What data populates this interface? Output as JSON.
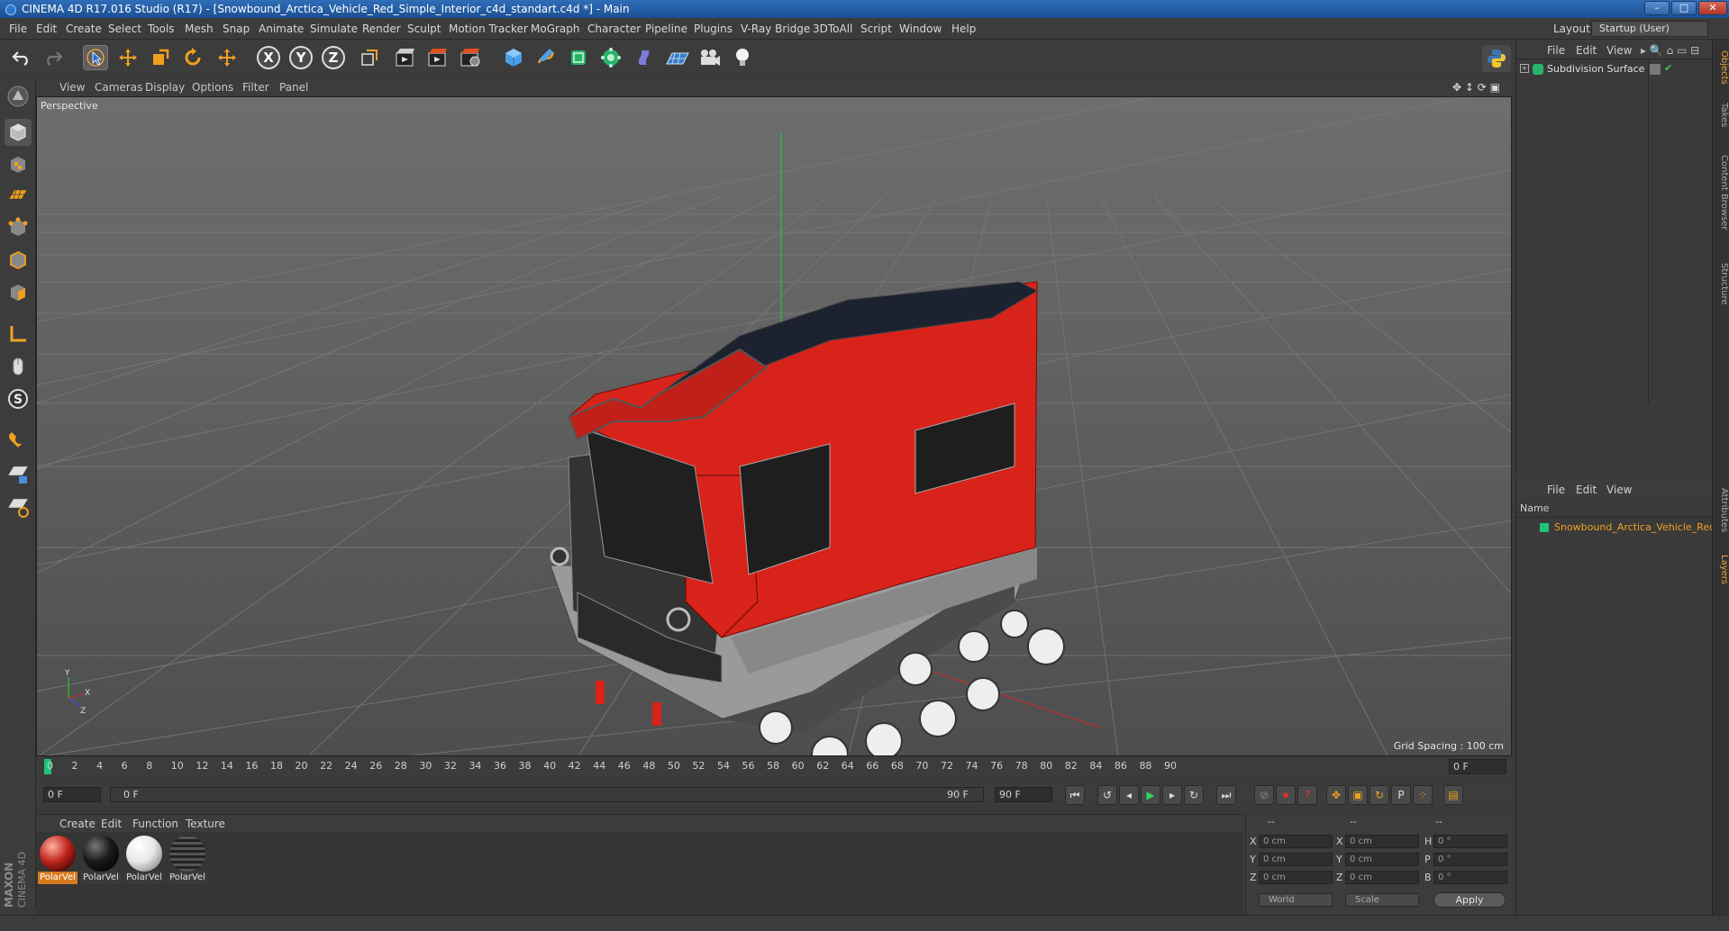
{
  "window": {
    "title": "CINEMA 4D R17.016 Studio (R17) - [Snowbound_Arctica_Vehicle_Red_Simple_Interior_c4d_standart.c4d *] - Main",
    "controls": [
      "–",
      "□",
      "✕"
    ]
  },
  "menubar": {
    "items": [
      "File",
      "Edit",
      "Create",
      "Select",
      "Tools",
      "Mesh",
      "Snap",
      "Animate",
      "Simulate",
      "Render",
      "Sculpt",
      "Motion Tracker",
      "MoGraph",
      "Character",
      "Pipeline",
      "Plugins",
      "V-Ray Bridge",
      "3DToAll",
      "Script",
      "Window",
      "Help"
    ],
    "layout_label": "Layout:",
    "layout_value": "Startup (User)"
  },
  "toolbar": {
    "axis_x": "X",
    "axis_y": "Y",
    "axis_z": "Z"
  },
  "viewport": {
    "menu": [
      "View",
      "Cameras",
      "Display",
      "Options",
      "Filter",
      "Panel"
    ],
    "label": "Perspective",
    "grid_spacing": "Grid Spacing : 100 cm",
    "axis_labels": {
      "y": "Y",
      "x": "X",
      "z": "Z"
    }
  },
  "timeline": {
    "ticks": [
      "0",
      "2",
      "4",
      "6",
      "8",
      "10",
      "12",
      "14",
      "16",
      "18",
      "20",
      "22",
      "24",
      "26",
      "28",
      "30",
      "32",
      "34",
      "36",
      "38",
      "40",
      "42",
      "44",
      "46",
      "48",
      "50",
      "52",
      "54",
      "56",
      "58",
      "60",
      "62",
      "64",
      "66",
      "68",
      "70",
      "72",
      "74",
      "76",
      "78",
      "80",
      "82",
      "84",
      "86",
      "88",
      "90"
    ],
    "current_frame": "0 F",
    "start_frame": "0 F",
    "range_start": "0 F",
    "range_end": "90 F",
    "end_frame": "90 F"
  },
  "materials": {
    "menu": [
      "Create",
      "Edit",
      "Function",
      "Texture"
    ],
    "items": [
      {
        "name": "PolarVel",
        "selected": true,
        "color": "#c0261e"
      },
      {
        "name": "PolarVel",
        "selected": false,
        "color": "#1a1a1a"
      },
      {
        "name": "PolarVel",
        "selected": false,
        "color": "#e8e8e8"
      },
      {
        "name": "PolarVel",
        "selected": false,
        "color": "#3a3a3a"
      }
    ]
  },
  "coords": {
    "header": [
      "--",
      "--",
      "--"
    ],
    "rows": [
      {
        "pl": "X",
        "pv": "0 cm",
        "sl": "X",
        "sv": "0 cm",
        "rl": "H",
        "rv": "0 °"
      },
      {
        "pl": "Y",
        "pv": "0 cm",
        "sl": "Y",
        "sv": "0 cm",
        "rl": "P",
        "rv": "0 °"
      },
      {
        "pl": "Z",
        "pv": "0 cm",
        "sl": "Z",
        "sv": "0 cm",
        "rl": "B",
        "rv": "0 °"
      }
    ],
    "mode": "World",
    "scale_mode": "Scale",
    "apply": "Apply"
  },
  "objects": {
    "menu": [
      "File",
      "Edit",
      "View"
    ],
    "items": [
      {
        "name": "Subdivision Surface"
      }
    ]
  },
  "layers": {
    "menu": [
      "File",
      "Edit",
      "View"
    ],
    "column": "Name",
    "items": [
      {
        "name": "Snowbound_Arctica_Vehicle_Red_",
        "color": "#1fc27a"
      }
    ]
  },
  "side_tabs": [
    "Objects",
    "Takes",
    "Content Browser",
    "Structure",
    "Attributes",
    "Layers"
  ],
  "branding": "MAXON CINEMA 4D",
  "colors": {
    "accent": "#d67a1e",
    "vehicle": "#d8231a",
    "title": "#2a62a8"
  }
}
